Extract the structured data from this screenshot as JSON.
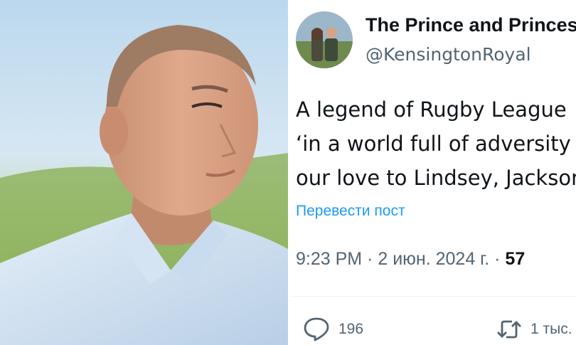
{
  "profile": {
    "display_name": "The Prince and Princess of Wales",
    "handle": "@KensingtonRoyal"
  },
  "tweet": {
    "lines": [
      "A legend of Rugby League",
      "‘in a world full of adversity",
      "our love to Lindsey, Jackson"
    ],
    "translate_label": "Перевести пост",
    "time": "9:23 PM",
    "date": "2 июн. 2024 г.",
    "views": "57"
  },
  "actions": {
    "replies_count": "196",
    "reposts_count": "1 тыс."
  },
  "icons": {
    "reply": "speech-bubble-icon",
    "repost": "repost-arrows-icon"
  },
  "colors": {
    "link": "#1d9bf0",
    "secondary_text": "#536471",
    "primary_text": "#0f1419"
  }
}
